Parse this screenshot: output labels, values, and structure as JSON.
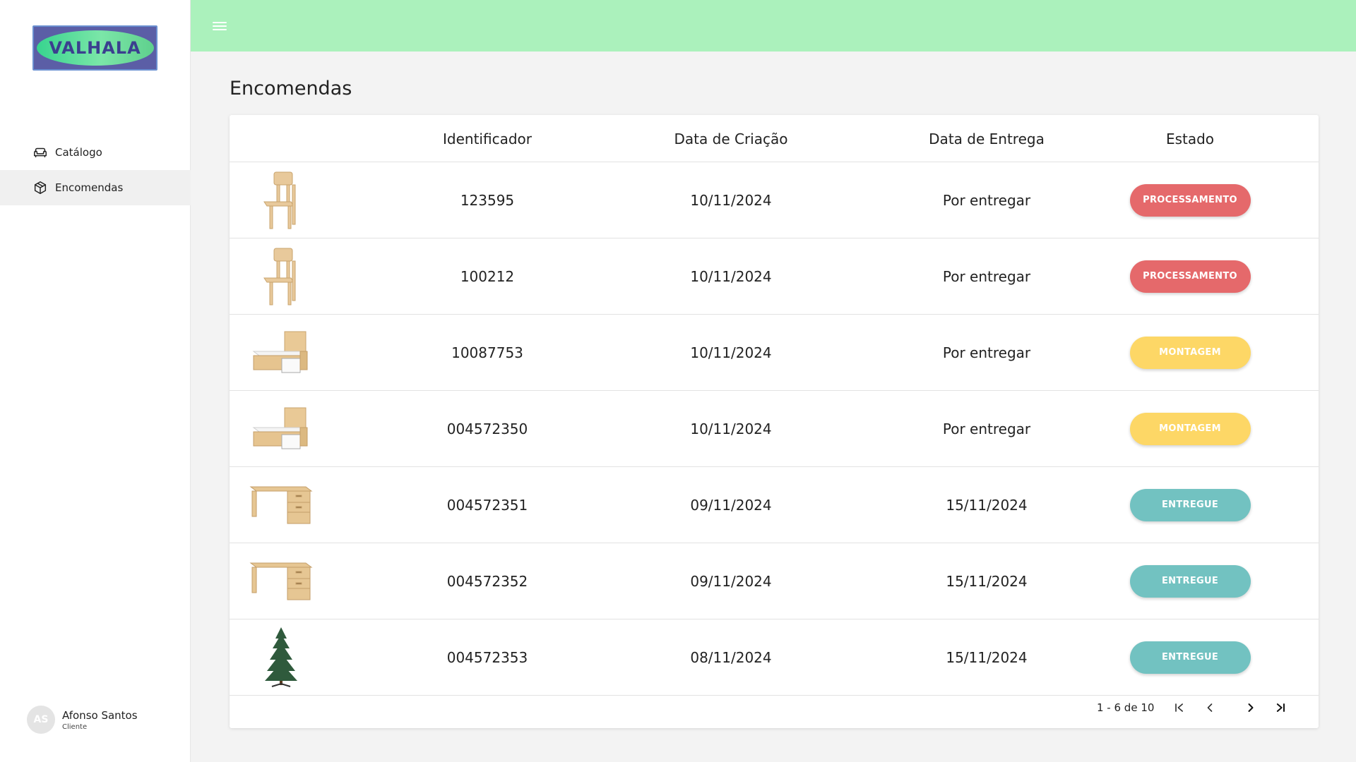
{
  "brand": {
    "logo_text": "VALHALA",
    "logo_bg": "#5b5ea6",
    "logo_pill": "#5fd08d"
  },
  "sidebar": {
    "items": [
      {
        "label": "Catálogo",
        "icon": "sofa-icon",
        "active": false
      },
      {
        "label": "Encomendas",
        "icon": "package-icon",
        "active": true
      }
    ]
  },
  "user": {
    "initials": "AS",
    "name": "Afonso Santos",
    "role": "Cliente"
  },
  "topbar": {
    "color": "#abf1bc",
    "menu_icon": "hamburger-icon"
  },
  "page": {
    "title": "Encomendas"
  },
  "table": {
    "headers": [
      "Identificador",
      "Data de Criação",
      "Data de Entrega",
      "Estado"
    ],
    "rows": [
      {
        "image": "chair",
        "id": "123595",
        "created": "10/11/2024",
        "delivery": "Por entregar",
        "status": "PROCESSAMENTO",
        "status_color": "#e5696b"
      },
      {
        "image": "chair",
        "id": "100212",
        "created": "10/11/2024",
        "delivery": "Por entregar",
        "status": "PROCESSAMENTO",
        "status_color": "#e5696b"
      },
      {
        "image": "bed",
        "id": "10087753",
        "created": "10/11/2024",
        "delivery": "Por entregar",
        "status": "MONTAGEM",
        "status_color": "#fdd766"
      },
      {
        "image": "bed",
        "id": "004572350",
        "created": "10/11/2024",
        "delivery": "Por entregar",
        "status": "MONTAGEM",
        "status_color": "#fdd766"
      },
      {
        "image": "desk",
        "id": "004572351",
        "created": "09/11/2024",
        "delivery": "15/11/2024",
        "status": "ENTREGUE",
        "status_color": "#72c2c1"
      },
      {
        "image": "desk",
        "id": "004572352",
        "created": "09/11/2024",
        "delivery": "15/11/2024",
        "status": "ENTREGUE",
        "status_color": "#72c2c1"
      },
      {
        "image": "tree",
        "id": "004572353",
        "created": "08/11/2024",
        "delivery": "15/11/2024",
        "status": "ENTREGUE",
        "status_color": "#72c2c1"
      }
    ]
  },
  "pagination": {
    "range_text": "1 - 6 de 10",
    "icons": [
      "first-page-icon",
      "previous-page-icon",
      "next-page-icon",
      "last-page-icon"
    ]
  }
}
